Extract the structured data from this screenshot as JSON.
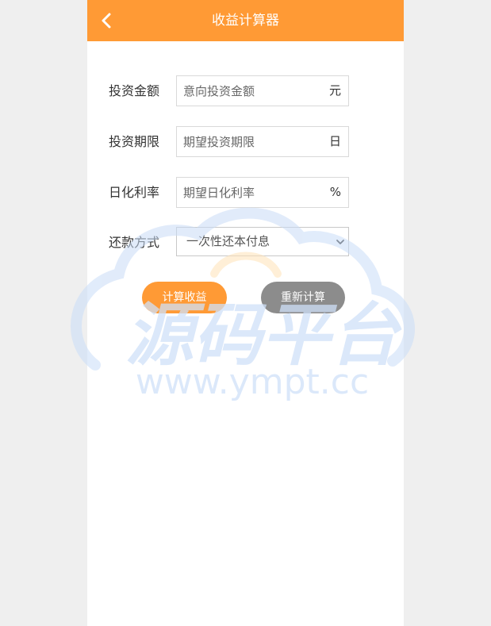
{
  "header": {
    "title": "收益计算器",
    "back_icon": "chevron-left-icon"
  },
  "form": {
    "amount": {
      "label": "投资金额",
      "placeholder": "意向投资金额",
      "value": "",
      "unit": "元"
    },
    "term": {
      "label": "投资期限",
      "placeholder": "期望投资期限",
      "value": "",
      "unit": "日"
    },
    "rate": {
      "label": "日化利率",
      "placeholder": "期望日化利率",
      "value": "",
      "unit": "%"
    },
    "repay": {
      "label": "还款方式",
      "selected": "一次性还本付息"
    }
  },
  "buttons": {
    "calc_label": "计算收益",
    "reset_label": "重新计算"
  },
  "watermark": {
    "main_text": "源码平台",
    "url_text": "www.ympt.cc"
  },
  "colors": {
    "accent": "#ff9a35",
    "reset": "#8c8c8c",
    "background": "#efefef",
    "watermark": "#d6e6fb"
  }
}
